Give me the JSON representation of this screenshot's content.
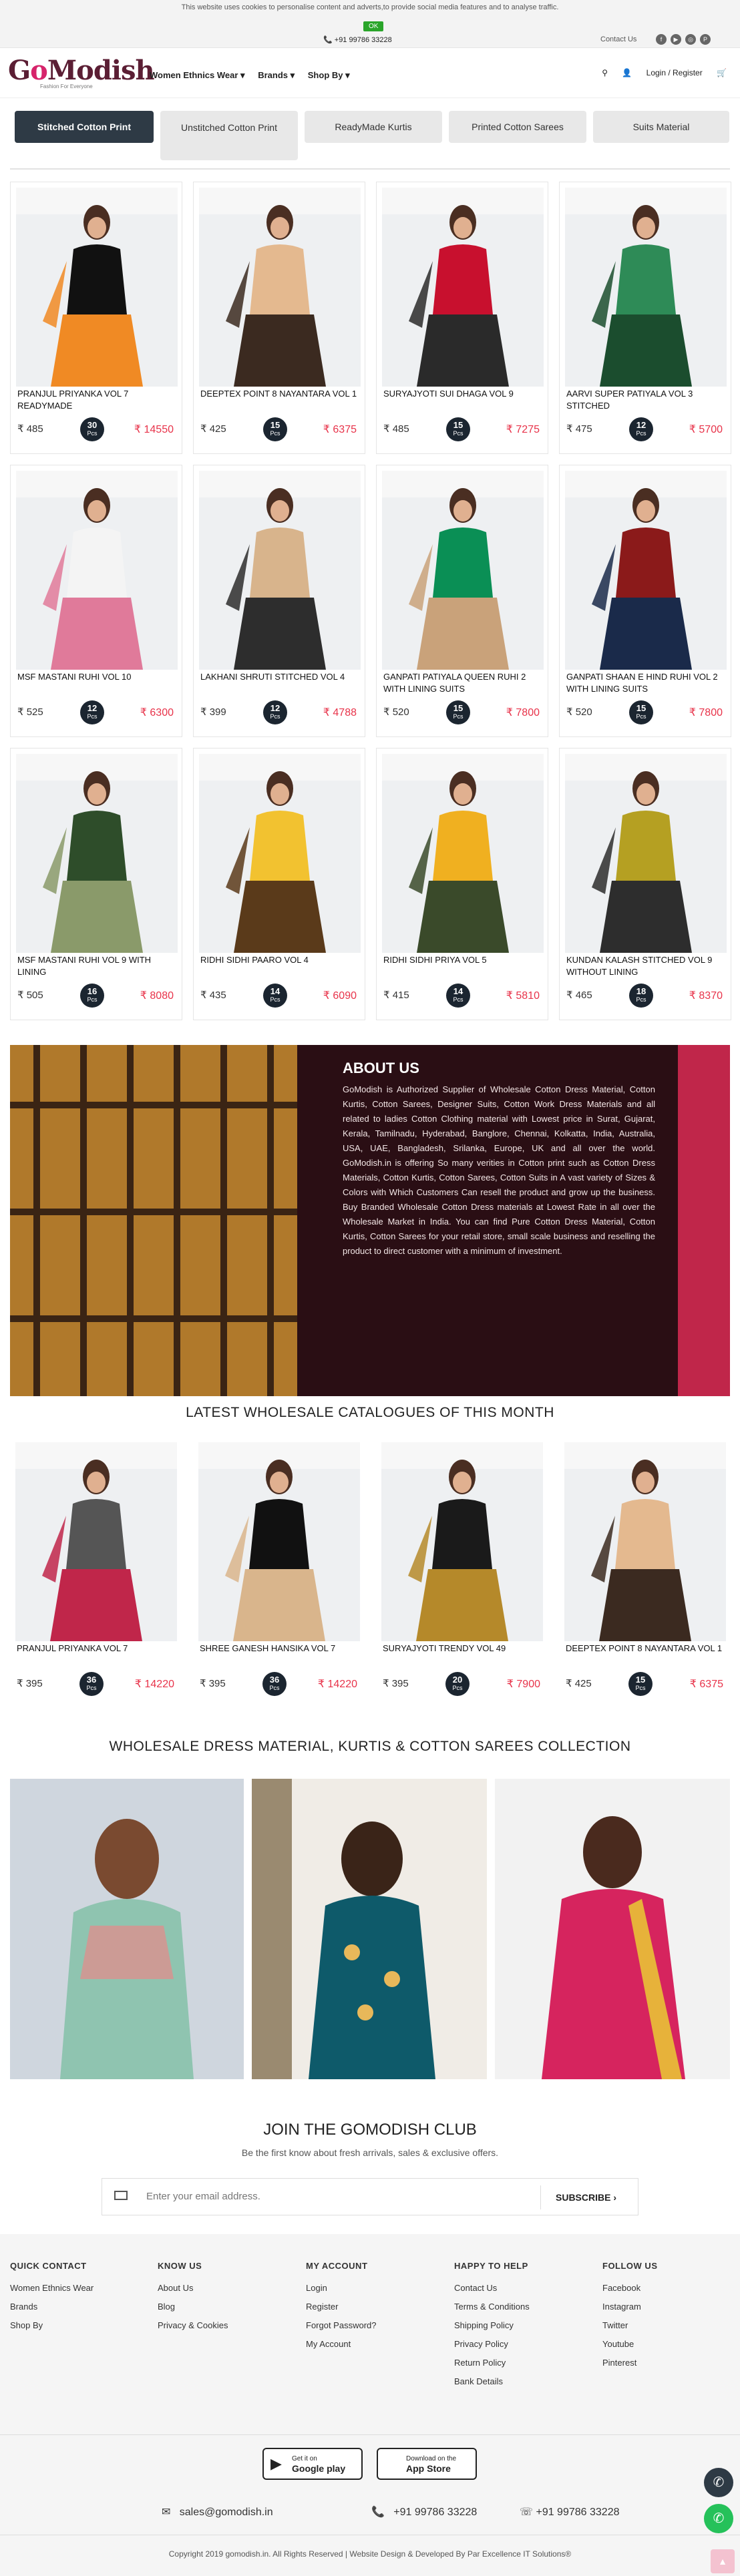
{
  "cookie": {
    "text": "This website uses cookies to personalise content and adverts,to provide social media features and to analyse traffic.",
    "ok": "OK"
  },
  "topbar": {
    "phone": "+91 99786 33228",
    "contact": "Contact Us",
    "social": [
      "f",
      "▶",
      "◎",
      "P"
    ]
  },
  "header": {
    "logo": "GoModish",
    "logo_tag": "Fashion For Everyone",
    "nav": [
      "Women Ethnics Wear ▾",
      "Brands ▾",
      "Shop By ▾"
    ],
    "login": "Login / Register"
  },
  "tabs": [
    "Stitched Cotton Print",
    "Unstitched Cotton Print",
    "ReadyMade Kurtis",
    "Printed Cotton Sarees",
    "Suits Material"
  ],
  "products": [
    {
      "title": "PRANJUL PRIYANKA VOL 7 READYMADE",
      "price": "₹ 485",
      "pcs": "30",
      "total": "₹ 14550",
      "c1": "#111",
      "c2": "#f08a24"
    },
    {
      "title": "DEEPTEX POINT 8 NAYANTARA VOL 1",
      "price": "₹ 425",
      "pcs": "15",
      "total": "₹ 6375",
      "c1": "#e4b98f",
      "c2": "#3b2a20"
    },
    {
      "title": "SURYAJYOTI SUI DHAGA VOL 9",
      "price": "₹ 485",
      "pcs": "15",
      "total": "₹ 7275",
      "c1": "#c8102e",
      "c2": "#2a2a2a"
    },
    {
      "title": "AARVI SUPER PATIYALA VOL 3 STITCHED",
      "price": "₹ 475",
      "pcs": "12",
      "total": "₹ 5700",
      "c1": "#2e8b57",
      "c2": "#1b4d2e"
    },
    {
      "title": "MSF MASTANI RUHI VOL 10",
      "price": "₹ 525",
      "pcs": "12",
      "total": "₹ 6300",
      "c1": "#f4f4f4",
      "c2": "#e07a9a"
    },
    {
      "title": "LAKHANI SHRUTI STITCHED VOL 4",
      "price": "₹ 399",
      "pcs": "12",
      "total": "₹ 4788",
      "c1": "#d8b48c",
      "c2": "#2d2d2d"
    },
    {
      "title": "GANPATI PATIYALA QUEEN RUHI 2 WITH LINING SUITS",
      "price": "₹ 520",
      "pcs": "15",
      "total": "₹ 7800",
      "c1": "#0a8f55",
      "c2": "#c9a27a"
    },
    {
      "title": "GANPATI SHAAN E HIND RUHI VOL 2 WITH LINING SUITS",
      "price": "₹ 520",
      "pcs": "15",
      "total": "₹ 7800",
      "c1": "#8b1a1a",
      "c2": "#1a2a4a"
    },
    {
      "title": "MSF MASTANI RUHI VOL 9 WITH LINING",
      "price": "₹ 505",
      "pcs": "16",
      "total": "₹ 8080",
      "c1": "#2e4d2a",
      "c2": "#8a9a6a"
    },
    {
      "title": "RIDHI SIDHI PAARO VOL 4",
      "price": "₹ 435",
      "pcs": "14",
      "total": "₹ 6090",
      "c1": "#f2c230",
      "c2": "#5a3a1a"
    },
    {
      "title": "RIDHI SIDHI PRIYA VOL 5",
      "price": "₹ 415",
      "pcs": "14",
      "total": "₹ 5810",
      "c1": "#f0b020",
      "c2": "#3a4a2a"
    },
    {
      "title": "KUNDAN KALASH STITCHED VOL 9 WITHOUT LINING",
      "price": "₹ 465",
      "pcs": "18",
      "total": "₹ 8370",
      "c1": "#b5a022",
      "c2": "#2d2d2d"
    }
  ],
  "about": {
    "heading": "ABOUT US",
    "text": "GoModish is Authorized Supplier of Wholesale Cotton Dress Material, Cotton Kurtis, Cotton Sarees, Designer Suits, Cotton Work Dress Materials and all related to ladies Cotton Clothing material with Lowest price in Surat, Gujarat, Kerala, Tamilnadu, Hyderabad, Banglore, Chennai, Kolkatta, India, Australia, USA, UAE, Bangladesh, Srilanka, Europe, UK and all over the world. GoModish.in is offering So many verities in Cotton print such as Cotton Dress Materials, Cotton Kurtis, Cotton Sarees, Cotton Suits in A vast variety of Sizes & Colors with Which Customers Can resell the product and grow up the business. Buy Branded Wholesale Cotton Dress materials at Lowest Rate in all over the Wholesale Market in India. You can find Pure Cotton Dress Material, Cotton Kurtis, Cotton Sarees for your retail store, small scale business and reselling the product to direct customer with a minimum of investment."
  },
  "latest": {
    "heading": "LATEST WHOLESALE CATALOGUES OF THIS MONTH",
    "items": [
      {
        "title": "PRANJUL PRIYANKA VOL 7",
        "price": "₹ 395",
        "pcs": "36",
        "total": "₹ 14220",
        "c1": "#555",
        "c2": "#c0264a"
      },
      {
        "title": "SHREE GANESH HANSIKA VOL 7",
        "price": "₹ 395",
        "pcs": "36",
        "total": "₹ 14220",
        "c1": "#111",
        "c2": "#d9b58c"
      },
      {
        "title": "SURYAJYOTI TRENDY VOL 49",
        "price": "₹ 395",
        "pcs": "20",
        "total": "₹ 7900",
        "c1": "#1a1a1a",
        "c2": "#b5892a"
      },
      {
        "title": "DEEPTEX POINT 8 NAYANTARA VOL 1",
        "price": "₹ 425",
        "pcs": "15",
        "total": "₹ 6375",
        "c1": "#e4b98f",
        "c2": "#3b2a20"
      }
    ]
  },
  "collection": {
    "heading": "WHOLESALE DRESS MATERIAL, KURTIS & COTTON SAREES COLLECTION"
  },
  "club": {
    "heading": "JOIN THE GOMODISH CLUB",
    "sub": "Be the first know about fresh arrivals, sales & exclusive offers.",
    "placeholder": "Enter your email address.",
    "button": "SUBSCRIBE ›"
  },
  "footer": {
    "cols": [
      {
        "h": "QUICK CONTACT",
        "items": [
          "Women Ethnics Wear",
          "Brands",
          "Shop By"
        ]
      },
      {
        "h": "KNOW US",
        "items": [
          "About Us",
          "Blog",
          "Privacy & Cookies"
        ]
      },
      {
        "h": "MY ACCOUNT",
        "items": [
          "Login",
          "Register",
          "Forgot Password?",
          "My Account"
        ]
      },
      {
        "h": "HAPPY TO HELP",
        "items": [
          "Contact Us",
          "Terms & Conditions",
          "Shipping Policy",
          "Privacy Policy",
          "Return Policy",
          "Bank Details"
        ]
      },
      {
        "h": "FOLLOW US",
        "items": [
          "Facebook",
          "Instagram",
          "Twitter",
          "Youtube",
          "Pinterest"
        ]
      }
    ],
    "google": {
      "small": "Get it on",
      "big": "Google play"
    },
    "apple": {
      "small": "Download on the",
      "big": "App Store"
    },
    "email": "sales@gomodish.in",
    "phone": "+91 99786 33228",
    "whatsapp": "+91 99786 33228",
    "copyright": "Copyright 2019 gomodish.in. All Rights Reserved | Website Design & Developed By Par Excellence IT Solutions®"
  }
}
